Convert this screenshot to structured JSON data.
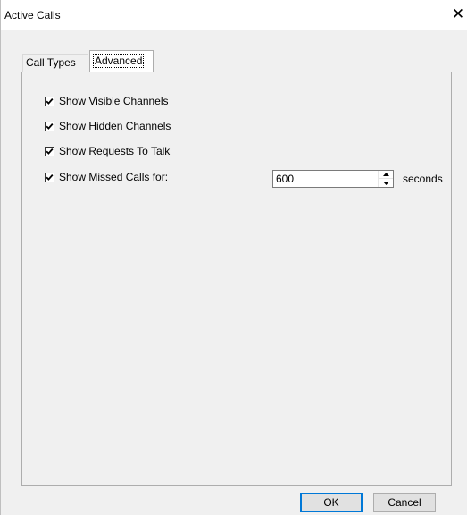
{
  "window": {
    "title": "Active Calls",
    "close_glyph": "✕"
  },
  "tabs": [
    {
      "label": "Call Types",
      "selected": false
    },
    {
      "label": "Advanced",
      "selected": true
    }
  ],
  "advanced": {
    "options": [
      {
        "label": "Show Visible Channels",
        "checked": true
      },
      {
        "label": "Show Hidden Channels",
        "checked": true
      },
      {
        "label": "Show Requests To Talk",
        "checked": true
      },
      {
        "label": "Show Missed Calls for:",
        "checked": true
      }
    ],
    "missed_calls_value": "600",
    "missed_calls_unit": "seconds"
  },
  "buttons": {
    "ok": "OK",
    "cancel": "Cancel"
  },
  "icons": {
    "close": "close-icon",
    "check": "checkmark-icon",
    "spin_up": "spin-up-arrow-icon",
    "spin_down": "spin-down-arrow-icon"
  },
  "colors": {
    "dialog_bg": "#f0f0f0",
    "title_bg": "#ffffff",
    "default_button_border": "#0078d7"
  }
}
